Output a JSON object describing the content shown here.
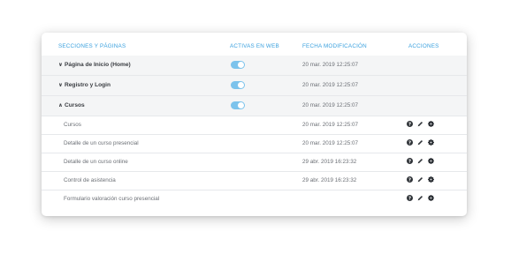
{
  "columns": {
    "sections": "SECCIONES Y PÁGINAS",
    "active_web": "ACTIVAS EN WEB",
    "modified": "FECHA MODIFICACIÓN",
    "actions": "ACCIONES"
  },
  "rows": [
    {
      "name": "Página de Inicio (Home)",
      "chevron": "chevron-down-icon",
      "active": true,
      "date": "20 mar. 2019 12:25:07"
    },
    {
      "name": "Registro y Login",
      "chevron": "chevron-down-icon",
      "active": true,
      "date": "20 mar. 2019 12:25:07"
    },
    {
      "name": "Cursos",
      "chevron": "chevron-up-icon",
      "active": true,
      "date": "20 mar. 2019 12:25:07"
    },
    {
      "name": "Cursos",
      "date": "20 mar. 2019 12:25:07",
      "actions": [
        "help-icon",
        "edit-icon",
        "settings-icon"
      ]
    },
    {
      "name": "Detalle de un curso presencial",
      "date": "20 mar. 2019 12:25:07",
      "actions": [
        "help-icon",
        "edit-icon",
        "settings-icon"
      ]
    },
    {
      "name": "Detalle de un curso online",
      "date": "29 abr. 2019 16:23:32",
      "actions": [
        "help-icon",
        "edit-icon",
        "settings-icon"
      ]
    },
    {
      "name": "Control de asistencia",
      "date": "29 abr. 2019 16:23:32",
      "actions": [
        "help-icon",
        "edit-icon",
        "settings-icon"
      ]
    },
    {
      "name": "Formulario valoración curso presencial",
      "date": "",
      "actions": [
        "help-icon",
        "edit-icon",
        "settings-icon"
      ]
    }
  ],
  "colors": {
    "header_text": "#3aa0de",
    "toggle_on": "#7cc3ec",
    "section_bg": "#f4f5f6"
  }
}
